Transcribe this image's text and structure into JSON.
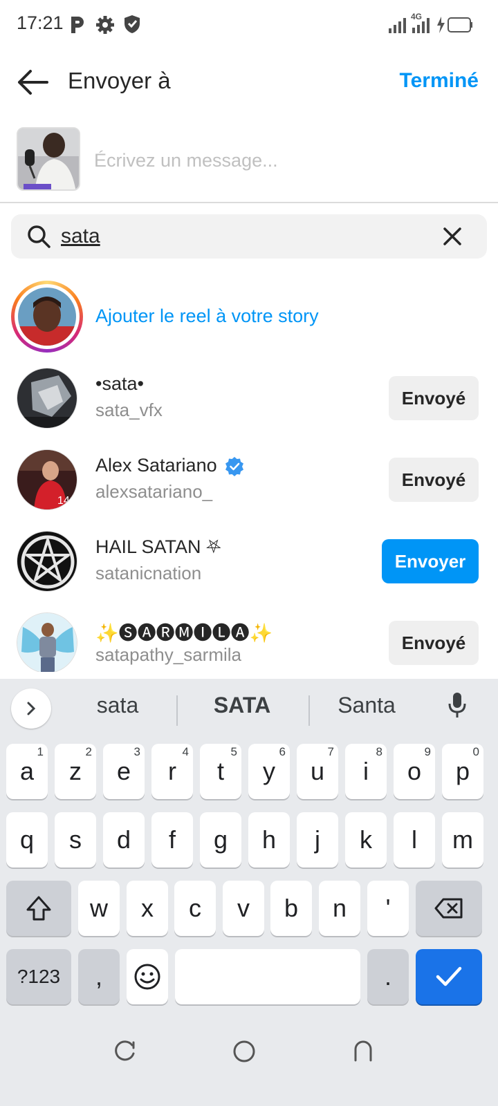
{
  "status_bar": {
    "time": "17:21",
    "network": "4G"
  },
  "header": {
    "title": "Envoyer à",
    "done_label": "Terminé"
  },
  "message": {
    "placeholder": "Écrivez un message..."
  },
  "search": {
    "value": "sata"
  },
  "story": {
    "label": "Ajouter le reel à votre story"
  },
  "results": [
    {
      "name": "•sata•",
      "handle": "sata_vfx",
      "verified": false,
      "action": "Envoyé"
    },
    {
      "name": "Alex Satariano",
      "handle": "alexsatariano_",
      "verified": true,
      "action": "Envoyé"
    },
    {
      "name": "HAIL SATAN ⛧",
      "handle": "satanicnation",
      "verified": false,
      "action": "Envoyer"
    },
    {
      "name": "✨🅢🅐🅡🅜🅘🅛🅐✨",
      "handle": "satapathy_sarmila",
      "verified": false,
      "action": "Envoyé"
    }
  ],
  "keyboard": {
    "suggestions": [
      "sata",
      "SATA",
      "Santa"
    ],
    "row1": [
      "a",
      "z",
      "e",
      "r",
      "t",
      "y",
      "u",
      "i",
      "o",
      "p"
    ],
    "row1_hints": [
      "1",
      "2",
      "3",
      "4",
      "5",
      "6",
      "7",
      "8",
      "9",
      "0"
    ],
    "row2": [
      "q",
      "s",
      "d",
      "f",
      "g",
      "h",
      "j",
      "k",
      "l",
      "m"
    ],
    "row3": [
      "w",
      "x",
      "c",
      "v",
      "b",
      "n",
      "'"
    ],
    "symbols_label": "?123",
    "comma": ",",
    "period": "."
  },
  "colors": {
    "accent": "#0095f6",
    "keyboard_enter": "#1a73e8",
    "verified": "#3897f0"
  }
}
